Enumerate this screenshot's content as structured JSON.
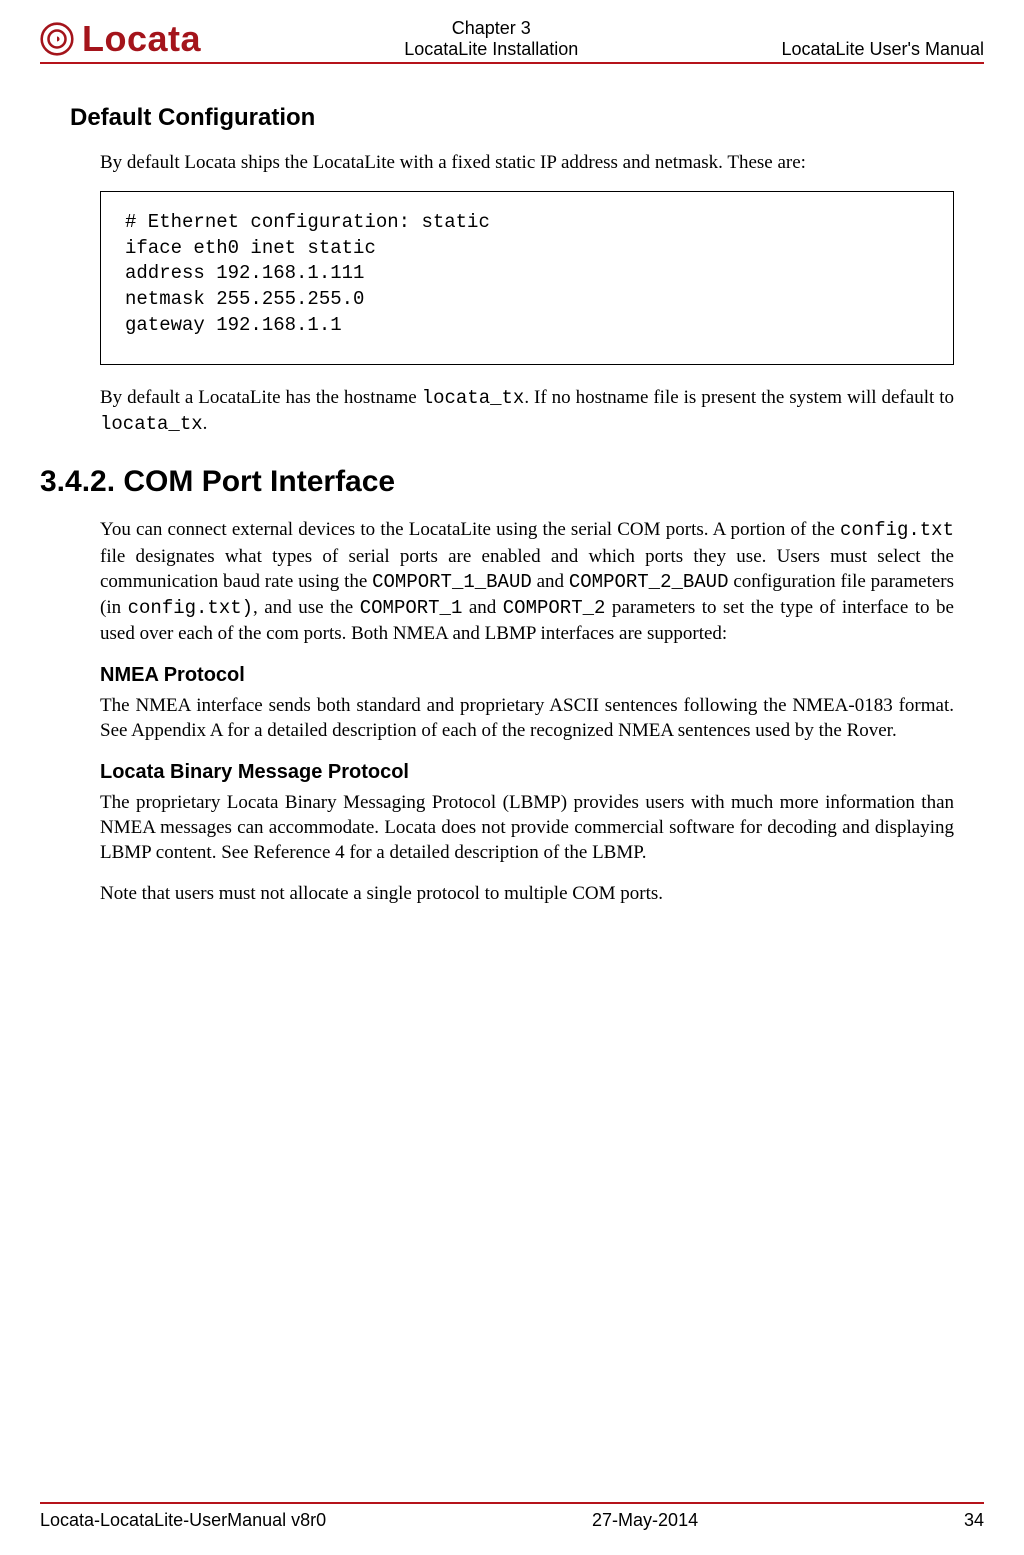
{
  "header": {
    "logo": {
      "text": "Locata",
      "tagline": ""
    },
    "chapter": "Chapter 3",
    "subtitle": "LocataLite Installation",
    "manual": "LocataLite User's Manual"
  },
  "section_default": {
    "heading": "Default Configuration",
    "intro": "By default Locata ships the LocataLite with a fixed static IP address and netmask. These are:",
    "code": "# Ethernet configuration: static\niface eth0 inet static\naddress 192.168.1.111\nnetmask 255.255.255.0\ngateway 192.168.1.1",
    "para2_a": "By default a LocataLite has the hostname ",
    "para2_code1": "locata_tx",
    "para2_b": ".  If no hostname file is present the system will default to ",
    "para2_code2": "locata_tx",
    "para2_c": "."
  },
  "section_com": {
    "heading": "3.4.2.   COM Port Interface",
    "para1_a": "You can connect external devices to the LocataLite using the serial COM ports.  A portion of the ",
    "para1_code1": "config.txt",
    "para1_b": " file designates what types of serial ports are enabled and which ports they use.  Users must select the communication baud rate using the ",
    "para1_code2": "COMPORT_1_BAUD",
    "para1_c": " and ",
    "para1_code3": "COMPORT_2_BAUD",
    "para1_d": " configuration file parameters (in ",
    "para1_code4": "config.txt)",
    "para1_e": ", and use the ",
    "para1_code5": "COMPORT_1",
    "para1_f": " and ",
    "para1_code6": "COMPORT_2",
    "para1_g": " parameters to set the type of interface to be used over each of the com ports. Both NMEA and LBMP interfaces are supported:",
    "nmea_heading": "NMEA Protocol",
    "nmea_para": "The NMEA interface sends both standard and proprietary ASCII sentences following the NMEA-0183 format.  See Appendix A for a detailed description of each of the recognized NMEA sentences used by the Rover.",
    "lbmp_heading": "Locata Binary Message Protocol",
    "lbmp_para": "The proprietary Locata Binary Messaging Protocol (LBMP) provides users with much more information than NMEA messages can accommodate.  Locata does not provide commercial software for decoding and displaying LBMP content.  See Reference 4 for a detailed description of the LBMP.",
    "note": "Note that users must not allocate a single protocol to multiple COM ports."
  },
  "footer": {
    "left": "Locata-LocataLite-UserManual v8r0",
    "center": "27-May-2014",
    "right": "34"
  }
}
